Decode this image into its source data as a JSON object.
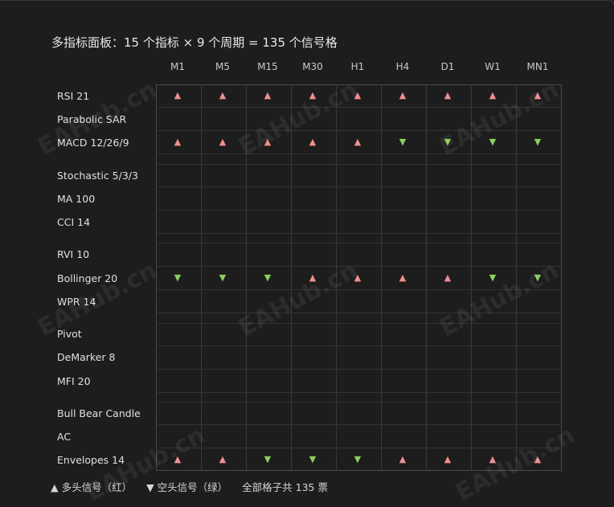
{
  "title": "多指标面板：15 个指标 × 9 个周期 = 135 个信号格",
  "periods": [
    "M1",
    "M5",
    "M15",
    "M30",
    "H1",
    "H4",
    "D1",
    "W1",
    "MN1"
  ],
  "indicators": [
    {
      "label": "RSI 21",
      "signals": [
        "up",
        "up",
        "up",
        "up",
        "up",
        "up",
        "up",
        "up",
        "up"
      ]
    },
    {
      "label": "Parabolic SAR",
      "signals": [
        "",
        "",
        "",
        "",
        "",
        "",
        "",
        "",
        ""
      ]
    },
    {
      "label": "MACD 12/26/9",
      "signals": [
        "up",
        "up",
        "up",
        "up",
        "up",
        "down",
        "down",
        "down",
        "down"
      ]
    },
    {
      "label": "Stochastic 5/3/3",
      "signals": [
        "",
        "",
        "",
        "",
        "",
        "",
        "",
        "",
        ""
      ]
    },
    {
      "label": "MA 100",
      "signals": [
        "",
        "",
        "",
        "",
        "",
        "",
        "",
        "",
        ""
      ]
    },
    {
      "label": "CCI 14",
      "signals": [
        "",
        "",
        "",
        "",
        "",
        "",
        "",
        "",
        ""
      ]
    },
    {
      "label": "RVI 10",
      "signals": [
        "",
        "",
        "",
        "",
        "",
        "",
        "",
        "",
        ""
      ]
    },
    {
      "label": "Bollinger 20",
      "signals": [
        "down",
        "down",
        "down",
        "up",
        "up",
        "up",
        "up",
        "down",
        "down"
      ]
    },
    {
      "label": "WPR 14",
      "signals": [
        "",
        "",
        "",
        "",
        "",
        "",
        "",
        "",
        ""
      ]
    },
    {
      "label": "Pivot",
      "signals": [
        "",
        "",
        "",
        "",
        "",
        "",
        "",
        "",
        ""
      ]
    },
    {
      "label": "DeMarker 8",
      "signals": [
        "",
        "",
        "",
        "",
        "",
        "",
        "",
        "",
        ""
      ]
    },
    {
      "label": "MFI 20",
      "signals": [
        "",
        "",
        "",
        "",
        "",
        "",
        "",
        "",
        ""
      ]
    },
    {
      "label": "Bull Bear Candle",
      "signals": [
        "",
        "",
        "",
        "",
        "",
        "",
        "",
        "",
        ""
      ]
    },
    {
      "label": "AC",
      "signals": [
        "",
        "",
        "",
        "",
        "",
        "",
        "",
        "",
        ""
      ]
    },
    {
      "label": "Envelopes 14",
      "signals": [
        "up",
        "up",
        "down",
        "down",
        "down",
        "up",
        "up",
        "up",
        "up"
      ]
    }
  ],
  "legend": {
    "bull": "▲ 多头信号（红）",
    "bear": "▼ 空头信号（绿）",
    "total": "全部格子共 135 票"
  },
  "symbols": {
    "up": "▲",
    "down": "▼"
  },
  "colors": {
    "bull": "#f08f8f",
    "bear": "#8fcf5e",
    "background": "#1d1d1d"
  },
  "watermark": "EAHub.cn"
}
